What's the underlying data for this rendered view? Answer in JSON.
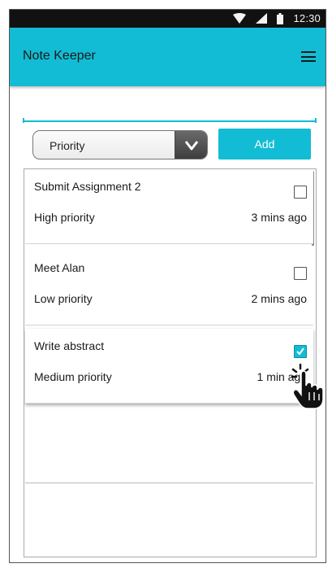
{
  "status_bar": {
    "time": "12:30"
  },
  "app_bar": {
    "title": "Note Keeper",
    "menu_icon": "hamburger-menu-icon"
  },
  "note_input": {
    "value": "",
    "placeholder": ""
  },
  "priority_select": {
    "selected": "Priority"
  },
  "add_button": {
    "label": "Add"
  },
  "notes": [
    {
      "title": "Submit Assignment 2",
      "priority": "High priority",
      "time": "3 mins ago",
      "checked": false
    },
    {
      "title": "Meet Alan",
      "priority": "Low priority",
      "time": "2 mins ago",
      "checked": false
    },
    {
      "title": "Write abstract",
      "priority": "Medium priority",
      "time": "1 min ago",
      "checked": true
    }
  ],
  "colors": {
    "accent": "#12bcd4",
    "status_bar": "#111111"
  }
}
